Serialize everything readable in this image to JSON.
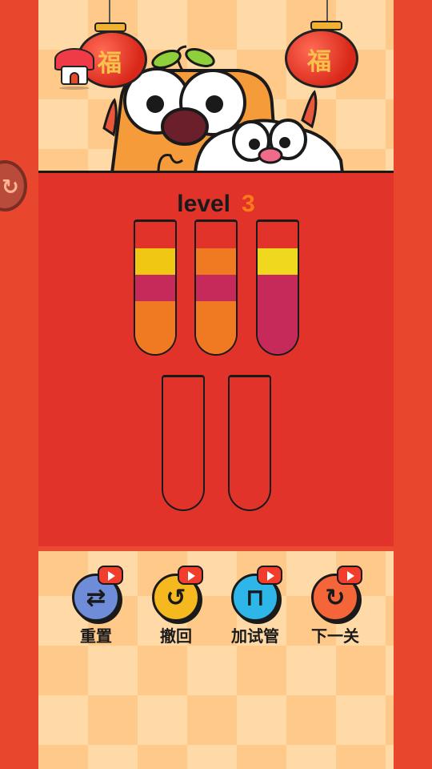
{
  "level": {
    "word": "level",
    "number": "3"
  },
  "lanterns": {
    "char": "福"
  },
  "buttons": [
    {
      "label": "重置",
      "icon": "reset-icon",
      "color": "#6e8cd8"
    },
    {
      "label": "撤回",
      "icon": "undo-icon",
      "color": "#f5b81e"
    },
    {
      "label": "加试管",
      "icon": "add-tube-icon",
      "color": "#2fb6e8"
    },
    {
      "label": "下一关",
      "icon": "next-level-icon",
      "color": "#f5653a"
    }
  ],
  "tubes": [
    {
      "layers": [
        "empty",
        "#f0c814",
        "#c62a5a",
        "#f07a22"
      ]
    },
    {
      "layers": [
        "empty",
        "#f07a22",
        "#c62a5a",
        "#f07a22"
      ]
    },
    {
      "layers": [
        "empty",
        "#f0d81e",
        "#c62a5a"
      ]
    },
    {
      "layers": []
    },
    {
      "layers": []
    }
  ],
  "colors": {
    "board": "#e2332b",
    "sides": "#e8472d"
  }
}
